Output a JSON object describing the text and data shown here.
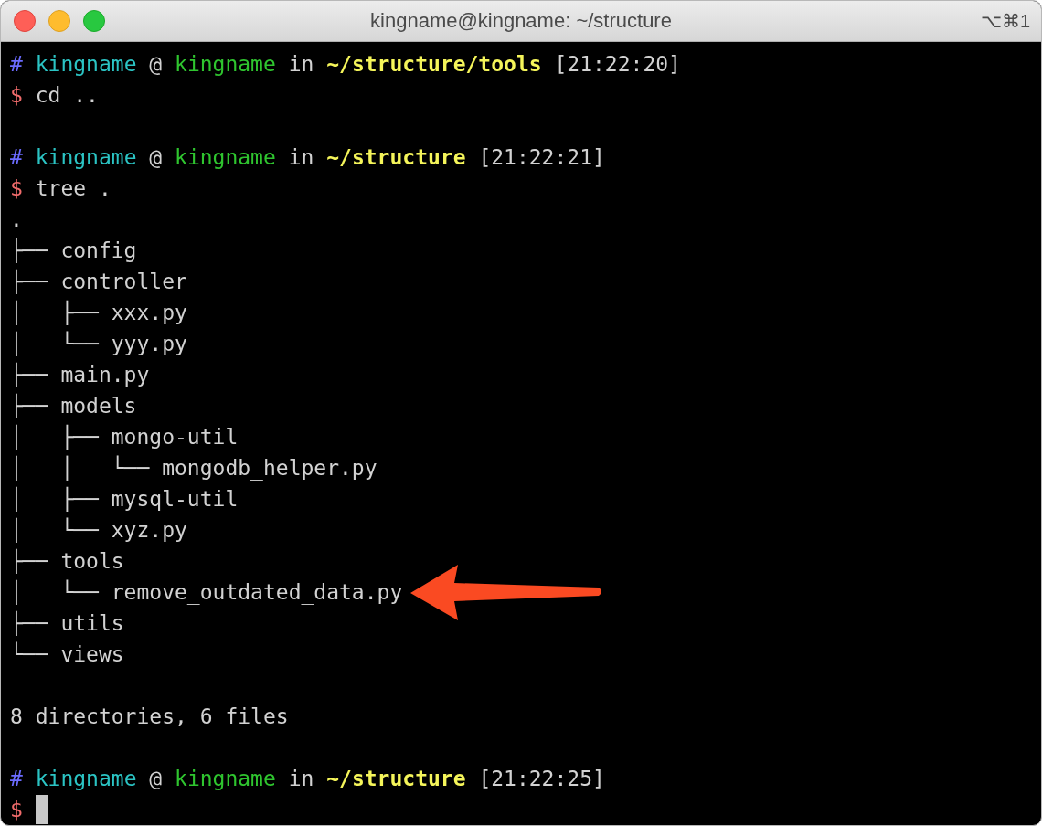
{
  "window": {
    "title": "kingname@kingname: ~/structure",
    "shortcut": "⌥⌘1"
  },
  "lines": [
    {
      "kind": "prompt",
      "symbol": "#",
      "user": "kingname",
      "at": "@",
      "host": "kingname",
      "in": "in",
      "path": "~/structure/tools",
      "time": "[21:22:20]"
    },
    {
      "kind": "command",
      "symbol": "$",
      "text": "cd .."
    },
    {
      "kind": "blank"
    },
    {
      "kind": "prompt",
      "symbol": "#",
      "user": "kingname",
      "at": "@",
      "host": "kingname",
      "in": "in",
      "path": "~/structure",
      "time": "[21:22:21]"
    },
    {
      "kind": "command",
      "symbol": "$",
      "text": "tree ."
    },
    {
      "kind": "output",
      "text": "."
    },
    {
      "kind": "output",
      "text": "├── config"
    },
    {
      "kind": "output",
      "text": "├── controller"
    },
    {
      "kind": "output",
      "text": "│   ├── xxx.py"
    },
    {
      "kind": "output",
      "text": "│   └── yyy.py"
    },
    {
      "kind": "output",
      "text": "├── main.py"
    },
    {
      "kind": "output",
      "text": "├── models"
    },
    {
      "kind": "output",
      "text": "│   ├── mongo-util"
    },
    {
      "kind": "output",
      "text": "│   │   └── mongodb_helper.py"
    },
    {
      "kind": "output",
      "text": "│   ├── mysql-util"
    },
    {
      "kind": "output",
      "text": "│   └── xyz.py"
    },
    {
      "kind": "output",
      "text": "├── tools"
    },
    {
      "kind": "output",
      "text": "│   └── remove_outdated_data.py",
      "arrow": true
    },
    {
      "kind": "output",
      "text": "├── utils"
    },
    {
      "kind": "output",
      "text": "└── views"
    },
    {
      "kind": "blank"
    },
    {
      "kind": "output",
      "text": "8 directories, 6 files"
    },
    {
      "kind": "blank"
    },
    {
      "kind": "prompt",
      "symbol": "#",
      "user": "kingname",
      "at": "@",
      "host": "kingname",
      "in": "in",
      "path": "~/structure",
      "time": "[21:22:25]"
    },
    {
      "kind": "command",
      "symbol": "$",
      "cursor": true
    }
  ]
}
